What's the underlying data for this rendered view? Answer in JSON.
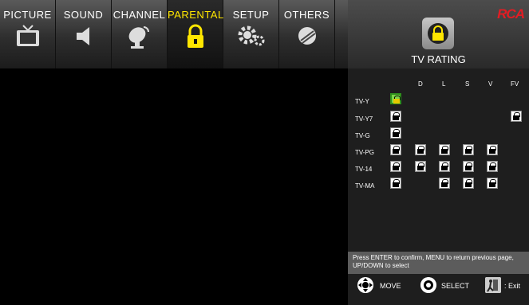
{
  "tabs": [
    {
      "label": "PICTURE",
      "icon": "tv-icon",
      "active": false
    },
    {
      "label": "SOUND",
      "icon": "speaker-icon",
      "active": false
    },
    {
      "label": "CHANNEL",
      "icon": "satellite-dish-icon",
      "active": false
    },
    {
      "label": "PARENTAL",
      "icon": "lock-icon",
      "active": true
    },
    {
      "label": "SETUP",
      "icon": "gears-icon",
      "active": false
    },
    {
      "label": "OTHERS",
      "icon": "others-disc-icon",
      "active": false
    }
  ],
  "brand": "RCA",
  "panel": {
    "title": "TV RATING",
    "columns": [
      "D",
      "L",
      "S",
      "V",
      "FV"
    ],
    "rows": [
      {
        "label": "TV-Y"
      },
      {
        "label": "TV-Y7"
      },
      {
        "label": "TV-G"
      },
      {
        "label": "TV-PG"
      },
      {
        "label": "TV-14"
      },
      {
        "label": "TV-MA"
      }
    ],
    "hint": "Press ENTER to confirm, MENU to return previous page, UP/DOWN to select"
  },
  "legend": {
    "move": "MOVE",
    "select": "SELECT",
    "exit": ": Exit"
  },
  "colors": {
    "accent": "#ffe600",
    "brand": "#e31c23",
    "selected": "#7cd64a"
  }
}
